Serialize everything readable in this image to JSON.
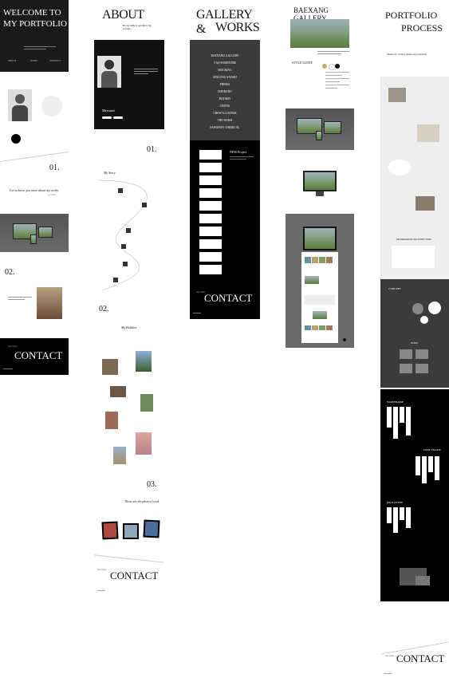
{
  "col1": {
    "hero_title_line1": "WELCOME TO",
    "hero_title_line2": "MY PORTFOLIO",
    "hero_nav": [
      "ABOUT",
      "WORK",
      "CONTACT"
    ],
    "section_number": "01.",
    "quote": "Get to know you more about my works",
    "quote_sub": "portfolio",
    "section_number_2": "02.",
    "contact_small": "Say hello",
    "contact_title": "CONTACT"
  },
  "col2": {
    "title": "ABOUT",
    "intro": "Hi, my name is and this is my portfolio",
    "name_label": "Maysunai",
    "num1": "01.",
    "journey_label": "My Story",
    "num2": "02.",
    "hobbies_label": "My Hobbies",
    "num3": "03.",
    "photos_caption": "These are the photos I took",
    "contact_small": "Say hello",
    "contact_title": "CONTACT"
  },
  "col3": {
    "title_line1": "GALLERY &",
    "title_line2": "WORKS",
    "works": [
      "BAEXANG GALLERY",
      "CAO SOMENTRE",
      "MOCKING",
      "SINGUNG SAFARI",
      "PREMA",
      "DAERANG",
      "BOOKIN",
      "CHUNG",
      "CREW A LOUNGE",
      "THE DOMA",
      "SANGHAN CHEMICAL"
    ],
    "side_heading": "NEW Project",
    "contact_small": "Say hello",
    "contact_title": "CONTACT"
  },
  "col4": {
    "title_line1": "BAEXANG",
    "title_line2": "GALLERY",
    "style_guide": "STYLE GUIDE",
    "palette": [
      "#c8a86b",
      "#ffffff",
      "#111111"
    ]
  },
  "col5": {
    "title_line1": "PORTFOLIO",
    "title_line2": "PROCESS",
    "quote": "Thanks for visiting, please enjoy portfolio",
    "info_arch": "INFORMATION ARCHITECTURE",
    "concept": "CONCEPT",
    "font": "FONT",
    "wireframe": "WIREFRAME",
    "wire_frame2": "WIRE FRAME",
    "prototype": "PROTOTYPE",
    "contact_small": "Say hello",
    "contact_title": "CONTACT"
  }
}
